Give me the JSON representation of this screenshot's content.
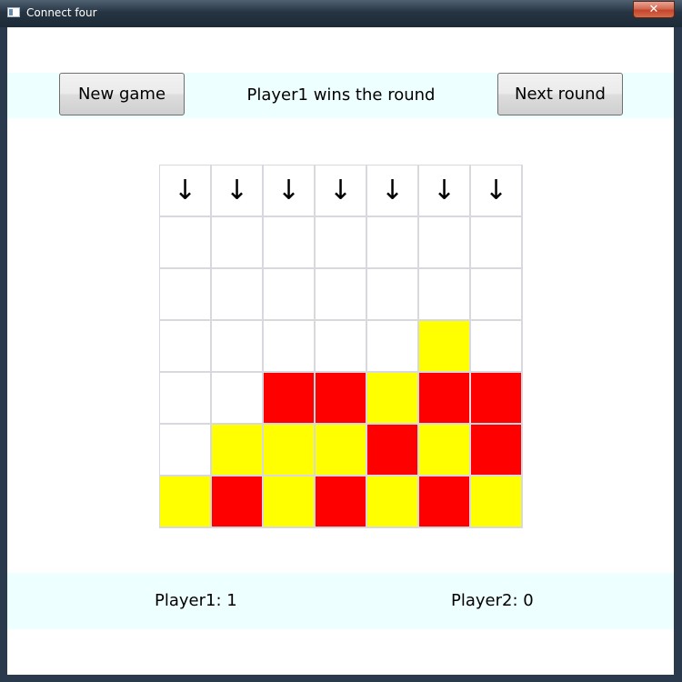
{
  "window": {
    "title": "Connect four",
    "close_label": "✕"
  },
  "header": {
    "new_game_label": "New game",
    "status": "Player1 wins the round",
    "next_round_label": "Next round"
  },
  "board": {
    "columns": 7,
    "rows": 6,
    "drop_arrow": "↓",
    "colors": {
      "red": "#ff0000",
      "yellow": "#ffff00",
      "empty": "#ffffff"
    },
    "cells_top_to_bottom": [
      [
        "empty",
        "empty",
        "empty",
        "empty",
        "empty",
        "empty",
        "empty"
      ],
      [
        "empty",
        "empty",
        "empty",
        "empty",
        "empty",
        "empty",
        "empty"
      ],
      [
        "empty",
        "empty",
        "empty",
        "empty",
        "empty",
        "yellow",
        "empty"
      ],
      [
        "empty",
        "empty",
        "red",
        "red",
        "yellow",
        "red",
        "red"
      ],
      [
        "empty",
        "yellow",
        "yellow",
        "yellow",
        "red",
        "yellow",
        "red"
      ],
      [
        "yellow",
        "red",
        "yellow",
        "red",
        "yellow",
        "red",
        "yellow"
      ]
    ]
  },
  "scores": {
    "player1": "Player1: 1",
    "player2": "Player2: 0"
  }
}
